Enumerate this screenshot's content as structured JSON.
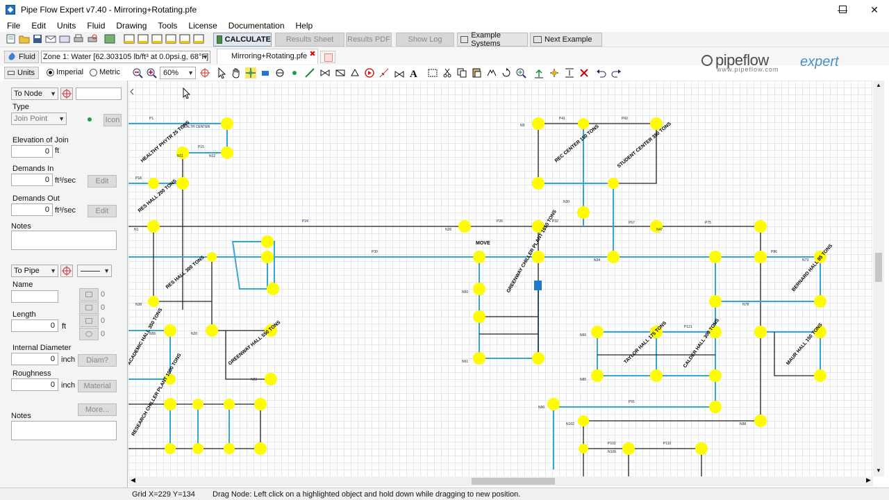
{
  "window": {
    "title": "Pipe Flow Expert v7.40 - Mirroring+Rotating.pfe"
  },
  "menu": [
    "File",
    "Edit",
    "Units",
    "Fluid",
    "Drawing",
    "Tools",
    "License",
    "Documentation",
    "Help"
  ],
  "toolbar": {
    "calculate": "CALCULATE",
    "results_sheet": "Results Sheet",
    "results_pdf": "Results PDF",
    "show_log": "Show Log",
    "example_systems": "Example Systems",
    "next_example": "Next Example"
  },
  "fluid": {
    "button": "Fluid",
    "zone": "Zone 1: Water [62.303105 lb/ft³ at 0.0psi.g, 68°F]"
  },
  "file_tab": {
    "name": "Mirroring+Rotating.pfe"
  },
  "units": {
    "button": "Units",
    "imperial": "Imperial",
    "metric": "Metric",
    "selected": "Imperial"
  },
  "zoom": {
    "level": "60%"
  },
  "logo": {
    "word1": "pipeflow",
    "word2": "expert",
    "url": "www.pipeflow.com"
  },
  "node_panel": {
    "selector": "To Node",
    "type_label": "Type",
    "type_value": "Join Point",
    "icon_button": "Icon",
    "elevation_label": "Elevation of Join",
    "elevation_value": "0",
    "elevation_unit": "ft",
    "demands_in_label": "Demands In",
    "demands_in_value": "0",
    "demands_in_unit": "ft³/sec",
    "demands_in_edit": "Edit",
    "demands_out_label": "Demands Out",
    "demands_out_value": "0",
    "demands_out_unit": "ft³/sec",
    "demands_out_edit": "Edit",
    "notes_label": "Notes"
  },
  "pipe_panel": {
    "selector": "To Pipe",
    "name_label": "Name",
    "length_label": "Length",
    "length_value": "0",
    "length_unit": "ft",
    "diameter_label": "Internal Diameter",
    "diameter_value": "0",
    "diameter_unit": "inch",
    "diam_button": "Diam?",
    "roughness_label": "Roughness",
    "roughness_value": "0",
    "roughness_unit": "inch",
    "material_button": "Material",
    "more_button": "More...",
    "notes_label": "Notes",
    "fitting_counts": [
      "0",
      "0",
      "0",
      "0"
    ]
  },
  "canvas_labels": {
    "move": "MOVE",
    "buildings": [
      "HEALTH CENTER",
      "HEALTHY PHYTR 25 TONS",
      "RES HALL 200 TONS",
      "RES HALL 300 TONS",
      "ACADEMIC HALL 350 TONS",
      "RESEARCH CHILLER PLANT 1000 TONS",
      "GREENWAY HALL 550 TONS",
      "REC CENTER 150 TONS",
      "STUDENT CENTER 350 TONS",
      "GREENWAY CHILLER PLANT 1650 TONS",
      "TAYLOR HALL 175 TONS",
      "CALDER HALL 300 TONS",
      "MAUR HALL 150 TONS",
      "BERNARD HALL 85 TONS"
    ],
    "pipe_ids": [
      "P1",
      "P15",
      "P24",
      "P30",
      "P18",
      "P26",
      "P32",
      "P41",
      "P60",
      "P67",
      "P75",
      "P86",
      "P91",
      "P102",
      "P110",
      "P121"
    ],
    "node_ids": [
      "N1",
      "N5",
      "N11",
      "N12",
      "N20",
      "N22",
      "N26",
      "N30",
      "N34",
      "N38",
      "N47",
      "N50",
      "N56",
      "N61",
      "N66",
      "N73",
      "N78",
      "N85",
      "N90",
      "N98",
      "N102",
      "N106"
    ]
  },
  "status": {
    "grid": "Grid  X=229  Y=134",
    "message": "Drag Node: Left click on a highlighted object and hold down while dragging to new position."
  }
}
